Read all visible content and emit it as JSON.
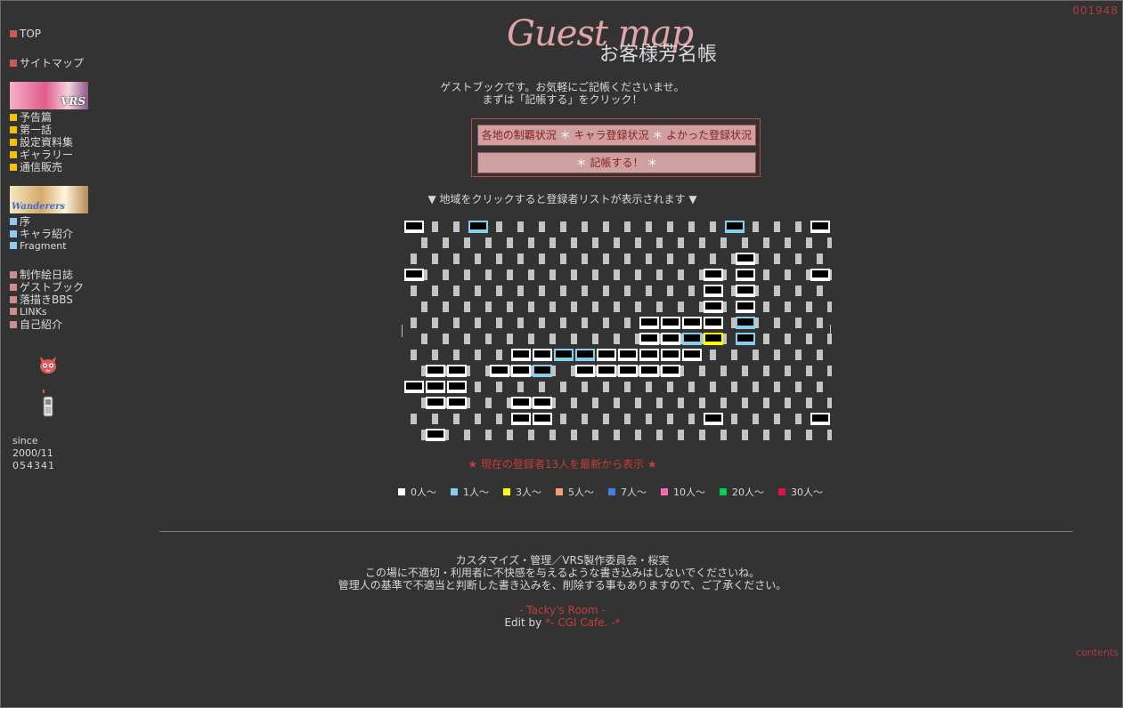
{
  "counter_top": "001948",
  "sidebar": {
    "top": "TOP",
    "sitemap": "サイトマップ",
    "vrs_banner": "VRS",
    "vrs_items": [
      "予告篇",
      "第一話",
      "設定資料集",
      "ギャラリー",
      "通信販売"
    ],
    "wanderers_banner": "Wanderers",
    "wanderers_items": [
      "序",
      "キャラ紹介",
      "Fragment"
    ],
    "misc_items": [
      "制作絵日誌",
      "ゲストブック",
      "落描きBBS",
      "LINKs",
      "自己紹介"
    ],
    "since_label": "since",
    "since_date": "2000/11",
    "visit_count": "054341"
  },
  "logo": {
    "script": "Guest map",
    "jp": "お客様芳名帳"
  },
  "intro": {
    "line1": "ゲストブックです。お気軽にご記帳くださいませ。",
    "line2": "まずは「記帳する」をクリック！"
  },
  "buttons": {
    "status_1": "各地の制覇状況",
    "status_2": "キャラ登録状況",
    "status_3": "よかった登録状況",
    "star": "＊",
    "register": "記帳する！"
  },
  "map_hint": "▼ 地域をクリックすると登録者リストが表示されます ▼",
  "show_all": "★ 現在の登録者13人を最新から表示 ★",
  "legend": [
    {
      "label": "0人〜",
      "color": "#ffffff"
    },
    {
      "label": "1人〜",
      "color": "#87ceeb"
    },
    {
      "label": "3人〜",
      "color": "#ffff00"
    },
    {
      "label": "5人〜",
      "color": "#f4a070"
    },
    {
      "label": "7人〜",
      "color": "#3f7fe8"
    },
    {
      "label": "10人〜",
      "color": "#ff69b4"
    },
    {
      "label": "20人〜",
      "color": "#00d050"
    },
    {
      "label": "30人〜",
      "color": "#e0104a"
    }
  ],
  "footer": {
    "line1": "カスタマイズ・管理／VRS製作委員会・桜実",
    "line2": "この場に不適切・利用者に不快感を与えるような書き込みはしないでくださいね。",
    "line3": "管理人の基準で不適当と判断した書き込みを、削除する事もありますので、ご了承ください。",
    "room": "- Tacky's Room -",
    "edit_by": "Edit by",
    "cgi": "*- CGI Cafe. -*"
  },
  "contents_link": "contents",
  "colors": {
    "accent_red": "#c83c3c",
    "bg": "#333333",
    "button_bg": "#cfa0a0"
  }
}
